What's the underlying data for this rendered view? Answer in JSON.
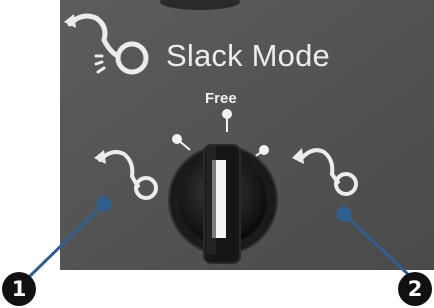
{
  "panel": {
    "title": "Slack Mode",
    "dial_label": "Free"
  },
  "callouts": [
    {
      "number": "1"
    },
    {
      "number": "2"
    }
  ],
  "icons": {
    "header": "slack-mode-loop-icon",
    "left": "slack-loop-left-icon",
    "right": "slack-loop-right-icon",
    "knob": "rotary-selector-knob"
  },
  "colors": {
    "panel": "#545454",
    "callout_line": "#2f5f8f",
    "callout_badge": "#111111"
  }
}
